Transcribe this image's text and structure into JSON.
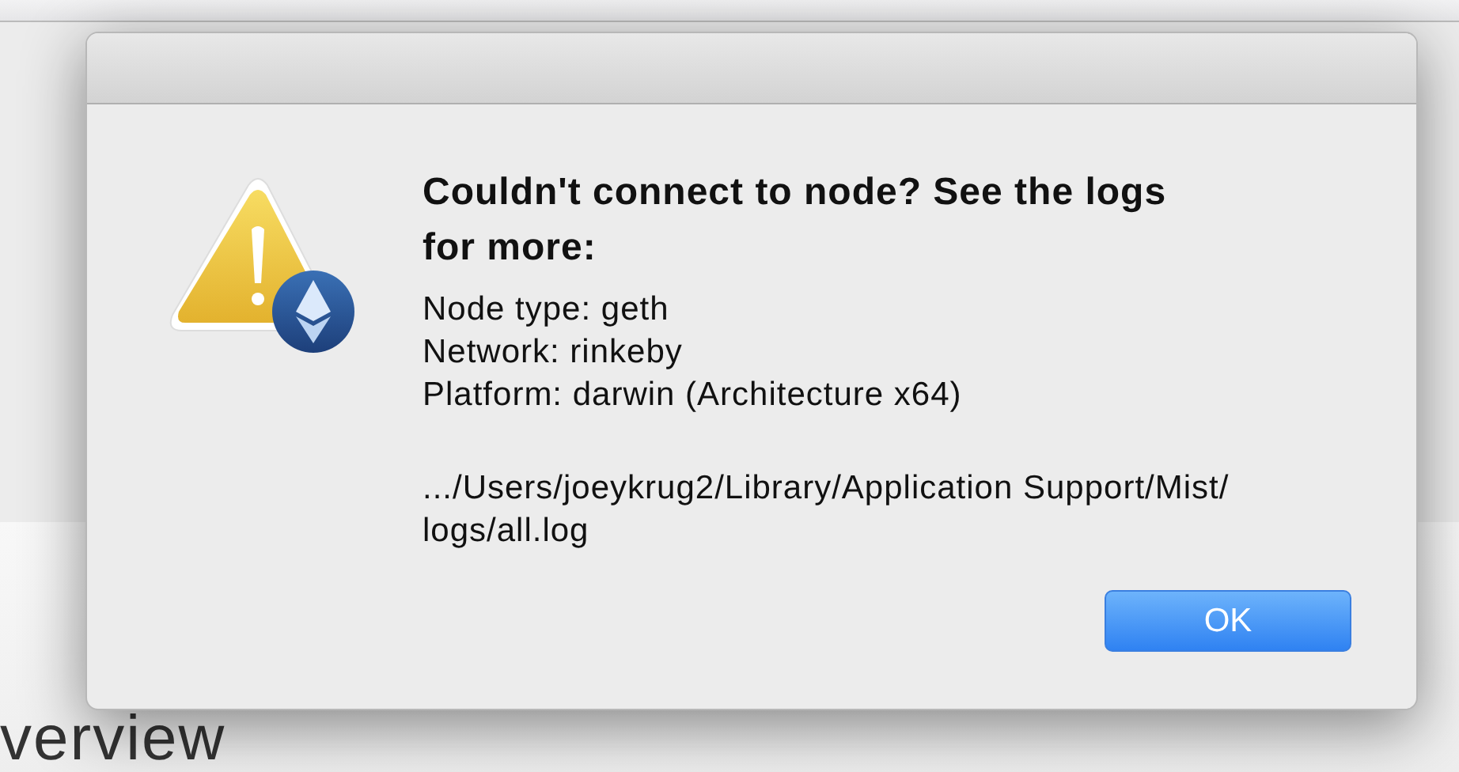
{
  "background": {
    "heading": "verview"
  },
  "dialog": {
    "title": "Couldn't connect to node? See the logs for more:",
    "details": [
      "Node type: geth",
      "Network: rinkeby",
      "Platform: darwin (Architecture x64)"
    ],
    "log_path": [
      ".../Users/joeykrug2/Library/Application Support/Mist/",
      "logs/all.log"
    ],
    "buttons": [
      {
        "label": "OK",
        "default": true
      }
    ]
  }
}
